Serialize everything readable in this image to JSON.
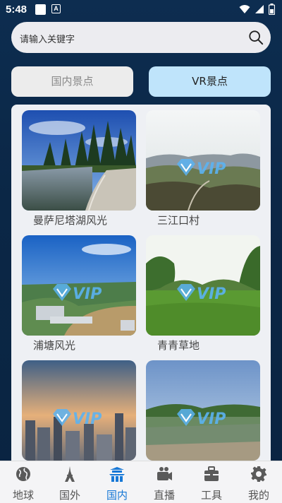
{
  "status": {
    "time": "5:48"
  },
  "search": {
    "placeholder": "请输入关键字"
  },
  "tabs": [
    {
      "label": "国内景点",
      "selected": false
    },
    {
      "label": "VR景点",
      "selected": true
    }
  ],
  "spots": [
    {
      "label": "曼萨尼塔湖风光",
      "vip": false,
      "scene": "lake"
    },
    {
      "label": "三江口村",
      "vip": true,
      "scene": "valley"
    },
    {
      "label": "浦塘风光",
      "vip": true,
      "scene": "town"
    },
    {
      "label": "青青草地",
      "vip": true,
      "scene": "grass"
    },
    {
      "label": "",
      "vip": true,
      "scene": "city"
    },
    {
      "label": "",
      "vip": true,
      "scene": "pond"
    }
  ],
  "nav": [
    {
      "label": "地球",
      "icon": "globe-icon",
      "active": false
    },
    {
      "label": "国外",
      "icon": "tower-icon",
      "active": false
    },
    {
      "label": "国内",
      "icon": "pagoda-icon",
      "active": true
    },
    {
      "label": "直播",
      "icon": "live-camera-icon",
      "active": false
    },
    {
      "label": "工具",
      "icon": "toolbox-icon",
      "active": false
    },
    {
      "label": "我的",
      "icon": "gear-icon",
      "active": false
    }
  ],
  "colors": {
    "accent": "#1677d6",
    "vr_tab_bg": "#bfe4fb",
    "background": "#0b2746"
  }
}
